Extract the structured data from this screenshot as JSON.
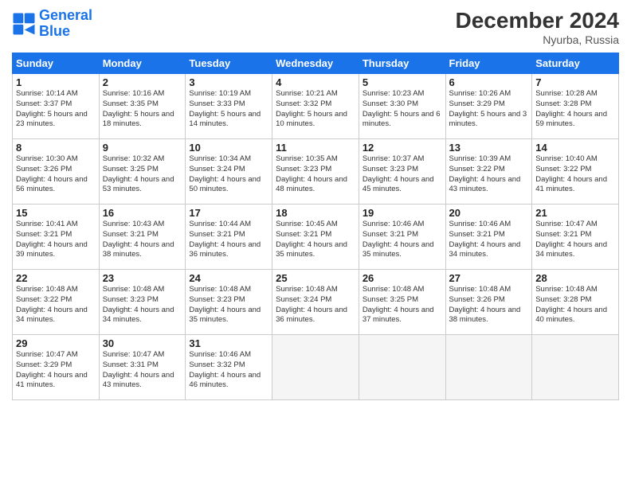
{
  "header": {
    "logo_line1": "General",
    "logo_line2": "Blue",
    "main_title": "December 2024",
    "subtitle": "Nyurba, Russia"
  },
  "weekdays": [
    "Sunday",
    "Monday",
    "Tuesday",
    "Wednesday",
    "Thursday",
    "Friday",
    "Saturday"
  ],
  "weeks": [
    [
      {
        "day": "1",
        "sunrise": "Sunrise: 10:14 AM",
        "sunset": "Sunset: 3:37 PM",
        "daylight": "Daylight: 5 hours and 23 minutes."
      },
      {
        "day": "2",
        "sunrise": "Sunrise: 10:16 AM",
        "sunset": "Sunset: 3:35 PM",
        "daylight": "Daylight: 5 hours and 18 minutes."
      },
      {
        "day": "3",
        "sunrise": "Sunrise: 10:19 AM",
        "sunset": "Sunset: 3:33 PM",
        "daylight": "Daylight: 5 hours and 14 minutes."
      },
      {
        "day": "4",
        "sunrise": "Sunrise: 10:21 AM",
        "sunset": "Sunset: 3:32 PM",
        "daylight": "Daylight: 5 hours and 10 minutes."
      },
      {
        "day": "5",
        "sunrise": "Sunrise: 10:23 AM",
        "sunset": "Sunset: 3:30 PM",
        "daylight": "Daylight: 5 hours and 6 minutes."
      },
      {
        "day": "6",
        "sunrise": "Sunrise: 10:26 AM",
        "sunset": "Sunset: 3:29 PM",
        "daylight": "Daylight: 5 hours and 3 minutes."
      },
      {
        "day": "7",
        "sunrise": "Sunrise: 10:28 AM",
        "sunset": "Sunset: 3:28 PM",
        "daylight": "Daylight: 4 hours and 59 minutes."
      }
    ],
    [
      {
        "day": "8",
        "sunrise": "Sunrise: 10:30 AM",
        "sunset": "Sunset: 3:26 PM",
        "daylight": "Daylight: 4 hours and 56 minutes."
      },
      {
        "day": "9",
        "sunrise": "Sunrise: 10:32 AM",
        "sunset": "Sunset: 3:25 PM",
        "daylight": "Daylight: 4 hours and 53 minutes."
      },
      {
        "day": "10",
        "sunrise": "Sunrise: 10:34 AM",
        "sunset": "Sunset: 3:24 PM",
        "daylight": "Daylight: 4 hours and 50 minutes."
      },
      {
        "day": "11",
        "sunrise": "Sunrise: 10:35 AM",
        "sunset": "Sunset: 3:23 PM",
        "daylight": "Daylight: 4 hours and 48 minutes."
      },
      {
        "day": "12",
        "sunrise": "Sunrise: 10:37 AM",
        "sunset": "Sunset: 3:23 PM",
        "daylight": "Daylight: 4 hours and 45 minutes."
      },
      {
        "day": "13",
        "sunrise": "Sunrise: 10:39 AM",
        "sunset": "Sunset: 3:22 PM",
        "daylight": "Daylight: 4 hours and 43 minutes."
      },
      {
        "day": "14",
        "sunrise": "Sunrise: 10:40 AM",
        "sunset": "Sunset: 3:22 PM",
        "daylight": "Daylight: 4 hours and 41 minutes."
      }
    ],
    [
      {
        "day": "15",
        "sunrise": "Sunrise: 10:41 AM",
        "sunset": "Sunset: 3:21 PM",
        "daylight": "Daylight: 4 hours and 39 minutes."
      },
      {
        "day": "16",
        "sunrise": "Sunrise: 10:43 AM",
        "sunset": "Sunset: 3:21 PM",
        "daylight": "Daylight: 4 hours and 38 minutes."
      },
      {
        "day": "17",
        "sunrise": "Sunrise: 10:44 AM",
        "sunset": "Sunset: 3:21 PM",
        "daylight": "Daylight: 4 hours and 36 minutes."
      },
      {
        "day": "18",
        "sunrise": "Sunrise: 10:45 AM",
        "sunset": "Sunset: 3:21 PM",
        "daylight": "Daylight: 4 hours and 35 minutes."
      },
      {
        "day": "19",
        "sunrise": "Sunrise: 10:46 AM",
        "sunset": "Sunset: 3:21 PM",
        "daylight": "Daylight: 4 hours and 35 minutes."
      },
      {
        "day": "20",
        "sunrise": "Sunrise: 10:46 AM",
        "sunset": "Sunset: 3:21 PM",
        "daylight": "Daylight: 4 hours and 34 minutes."
      },
      {
        "day": "21",
        "sunrise": "Sunrise: 10:47 AM",
        "sunset": "Sunset: 3:21 PM",
        "daylight": "Daylight: 4 hours and 34 minutes."
      }
    ],
    [
      {
        "day": "22",
        "sunrise": "Sunrise: 10:48 AM",
        "sunset": "Sunset: 3:22 PM",
        "daylight": "Daylight: 4 hours and 34 minutes."
      },
      {
        "day": "23",
        "sunrise": "Sunrise: 10:48 AM",
        "sunset": "Sunset: 3:23 PM",
        "daylight": "Daylight: 4 hours and 34 minutes."
      },
      {
        "day": "24",
        "sunrise": "Sunrise: 10:48 AM",
        "sunset": "Sunset: 3:23 PM",
        "daylight": "Daylight: 4 hours and 35 minutes."
      },
      {
        "day": "25",
        "sunrise": "Sunrise: 10:48 AM",
        "sunset": "Sunset: 3:24 PM",
        "daylight": "Daylight: 4 hours and 36 minutes."
      },
      {
        "day": "26",
        "sunrise": "Sunrise: 10:48 AM",
        "sunset": "Sunset: 3:25 PM",
        "daylight": "Daylight: 4 hours and 37 minutes."
      },
      {
        "day": "27",
        "sunrise": "Sunrise: 10:48 AM",
        "sunset": "Sunset: 3:26 PM",
        "daylight": "Daylight: 4 hours and 38 minutes."
      },
      {
        "day": "28",
        "sunrise": "Sunrise: 10:48 AM",
        "sunset": "Sunset: 3:28 PM",
        "daylight": "Daylight: 4 hours and 40 minutes."
      }
    ],
    [
      {
        "day": "29",
        "sunrise": "Sunrise: 10:47 AM",
        "sunset": "Sunset: 3:29 PM",
        "daylight": "Daylight: 4 hours and 41 minutes."
      },
      {
        "day": "30",
        "sunrise": "Sunrise: 10:47 AM",
        "sunset": "Sunset: 3:31 PM",
        "daylight": "Daylight: 4 hours and 43 minutes."
      },
      {
        "day": "31",
        "sunrise": "Sunrise: 10:46 AM",
        "sunset": "Sunset: 3:32 PM",
        "daylight": "Daylight: 4 hours and 46 minutes."
      },
      null,
      null,
      null,
      null
    ]
  ]
}
